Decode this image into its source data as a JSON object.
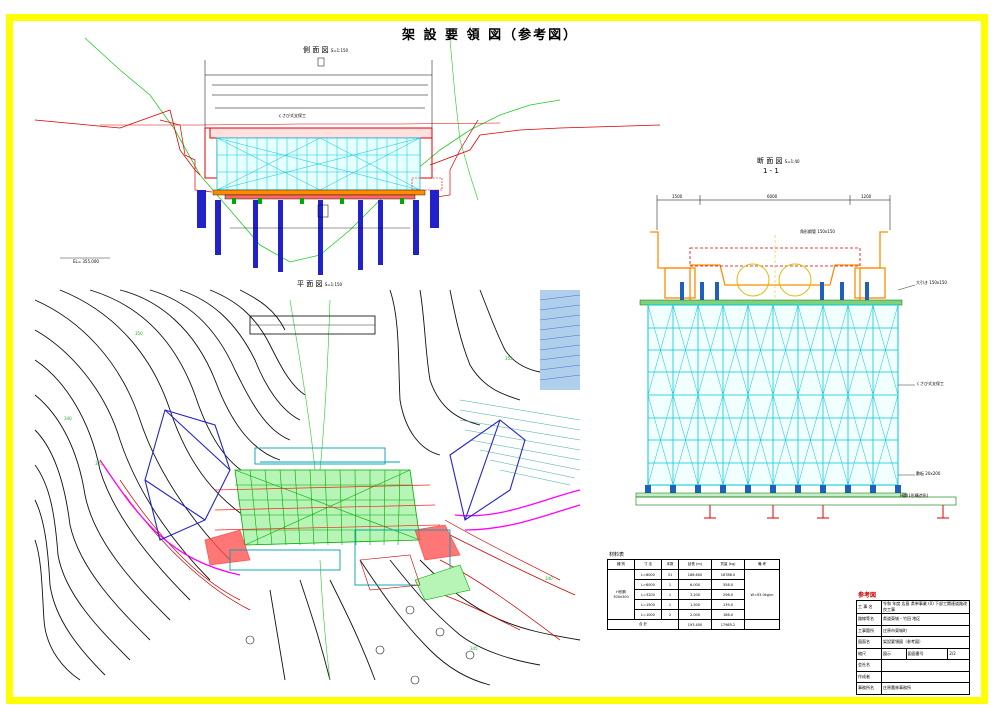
{
  "title": "架 設 要 領 図（参考図）",
  "views": {
    "side": {
      "label": "側 面 図",
      "scale": "S=1:150"
    },
    "plan": {
      "label": "平 面 図",
      "scale": "S=1:150"
    },
    "section": {
      "label": "断 面 図",
      "number": "1 - 1",
      "scale": "S=1:40"
    }
  },
  "annotations": {
    "el_left": "EL= 355.000",
    "support_label": "くさび式支保工",
    "section_support": "くさび式支保工",
    "section_width_left": "1500",
    "section_width_mid": "6000",
    "section_width_right": "1200",
    "section_top_note": "角形鋼管 150x150",
    "section_right_a": "大引き 150x150",
    "section_right_b": "敷板 20x200",
    "section_right_c": "H鋼(L形構造形)"
  },
  "materials": {
    "caption": "材料表",
    "headers": [
      "種 別",
      "寸 法",
      "本数",
      "延長 (m)",
      "質量 (kg)",
      "備 考"
    ],
    "group": "H形鋼\n300x300",
    "rows": [
      [
        "L=6000",
        "31",
        "186.600",
        "16786.0"
      ],
      [
        "L=6000",
        "1",
        "6.000",
        "558.0"
      ],
      [
        "L=3200",
        "1",
        "3.200",
        "298.0"
      ],
      [
        "L=1500",
        "1",
        "1.500",
        "139.0"
      ],
      [
        "L=1000",
        "2",
        "2.000",
        "186.0"
      ]
    ],
    "remark": "W=93.0kg/m",
    "total_label": "合 計",
    "total_length": "193.400",
    "total_mass": "17985.2"
  },
  "title_block": {
    "header": "参考図",
    "rows": [
      [
        "工 事 名",
        "令和 年度 広島 県単事業 (0) 下部工関連道路改良工事"
      ],
      [
        "路線等名",
        "県道東城・竹田 地区"
      ],
      [
        "工事箇所",
        "庄原市東城町"
      ],
      [
        "図面名",
        "架設要領図（参考図）"
      ],
      [
        "縮尺",
        "図示",
        "図面番号",
        "2/2"
      ],
      [
        "会社名",
        ""
      ],
      [
        "作成者",
        ""
      ],
      [
        "事務所名",
        "庄原農林事務所"
      ]
    ]
  }
}
